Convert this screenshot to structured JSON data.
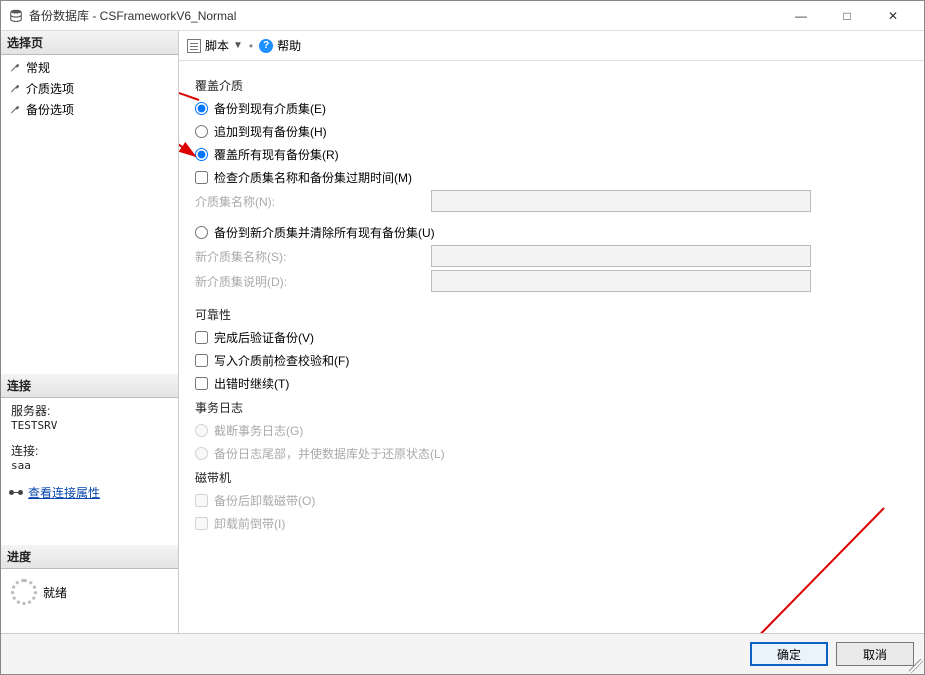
{
  "window": {
    "title": "备份数据库 - CSFrameworkV6_Normal",
    "min": "—",
    "max": "□",
    "close": "✕"
  },
  "sidebar": {
    "select_page_hdr": "选择页",
    "items": [
      {
        "label": "常规"
      },
      {
        "label": "介质选项"
      },
      {
        "label": "备份选项"
      }
    ],
    "connection_hdr": "连接",
    "server_label": "服务器:",
    "server_value": "TESTSRV",
    "conn_label": "连接:",
    "conn_value": "saa",
    "view_conn_props": "查看连接属性",
    "progress_hdr": "进度",
    "progress_status": "就绪"
  },
  "toolbar": {
    "script_label": "脚本",
    "help_label": "帮助"
  },
  "form": {
    "overwrite_media_hdr": "覆盖介质",
    "radio_backup_existing": "备份到现有介质集(E)",
    "radio_append_existing": "追加到现有备份集(H)",
    "radio_overwrite_all": "覆盖所有现有备份集(R)",
    "chk_check_mediaset": "检查介质集名称和备份集过期时间(M)",
    "mediaset_name_label": "介质集名称(N):",
    "radio_backup_new_mediaset": "备份到新介质集并清除所有现有备份集(U)",
    "new_mediaset_name_label": "新介质集名称(S):",
    "new_mediaset_desc_label": "新介质集说明(D):",
    "reliability_hdr": "可靠性",
    "chk_verify_after": "完成后验证备份(V)",
    "chk_checksum_before": "写入介质前检查校验和(F)",
    "chk_continue_on_error": "出错时继续(T)",
    "txlog_hdr": "事务日志",
    "radio_truncate_txlog": "截断事务日志(G)",
    "radio_backup_tail": "备份日志尾部，并使数据库处于还原状态(L)",
    "tape_hdr": "磁带机",
    "chk_unload_after": "备份后卸载磁带(O)",
    "chk_rewind_before": "卸载前倒带(I)"
  },
  "footer": {
    "ok": "确定",
    "cancel": "取消"
  }
}
